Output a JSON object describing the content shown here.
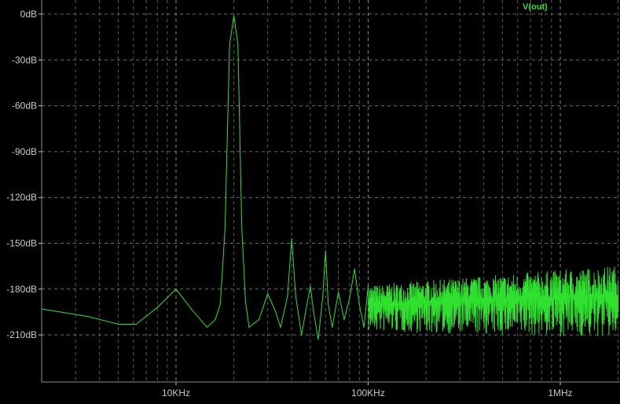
{
  "chart_data": {
    "type": "line",
    "xscale": "log",
    "xlim_hz": [
      2000,
      2000000
    ],
    "ylim_db": [
      -240,
      0
    ],
    "yticks": [
      {
        "value": 0,
        "label": "0dB"
      },
      {
        "value": -30,
        "label": "-30dB"
      },
      {
        "value": -60,
        "label": "-60dB"
      },
      {
        "value": -90,
        "label": "-90dB"
      },
      {
        "value": -120,
        "label": "-120dB"
      },
      {
        "value": -150,
        "label": "-150dB"
      },
      {
        "value": -180,
        "label": "-180dB"
      },
      {
        "value": -210,
        "label": "-210dB"
      }
    ],
    "xticks": [
      {
        "value": 10000,
        "label": "10KHz"
      },
      {
        "value": 100000,
        "label": "100KHz"
      },
      {
        "value": 1000000,
        "label": "1MHz"
      }
    ],
    "grid": true,
    "legend": "top-right",
    "series": [
      {
        "name": "V(out)",
        "color": "#2fe02f",
        "x": [
          2000,
          3500,
          5000,
          5400,
          6200,
          8000,
          10000,
          12000,
          14500,
          16000,
          17000,
          18000,
          19000,
          20000,
          21000,
          22000,
          23000,
          24000,
          27000,
          30000,
          33000,
          35000,
          38000,
          40000,
          42000,
          45000,
          48000,
          50000,
          52000,
          55000,
          58000,
          60000,
          62000,
          65000,
          70000,
          75000,
          80000,
          85000,
          90000,
          95000,
          100000
        ],
        "y": [
          -193,
          -198,
          -203,
          -203,
          -203,
          -192,
          -180,
          -193,
          -205,
          -200,
          -190,
          -140,
          -20,
          -1,
          -20,
          -140,
          -188,
          -205,
          -200,
          -183,
          -195,
          -205,
          -185,
          -147,
          -185,
          -210,
          -190,
          -178,
          -195,
          -213,
          -185,
          -155,
          -190,
          -205,
          -182,
          -200,
          -186,
          -167,
          -190,
          -205,
          -178
        ]
      }
    ]
  }
}
